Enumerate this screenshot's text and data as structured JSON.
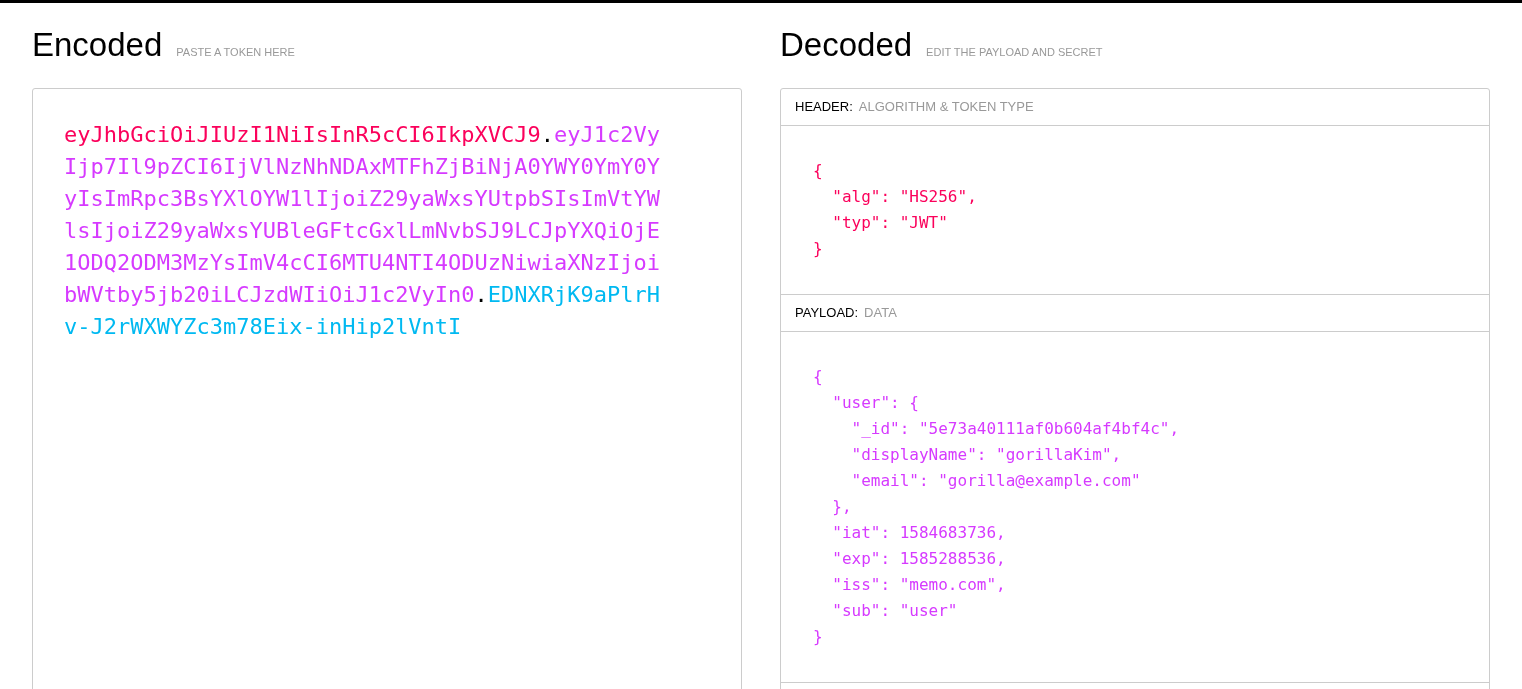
{
  "encoded": {
    "title": "Encoded",
    "hint": "PASTE A TOKEN HERE",
    "token": [
      {
        "text": "eyJhbGciOiJIUzI1NiIsInR5cCI6IkpXVCJ9",
        "color": "#fb015b"
      },
      {
        "text": ".",
        "color": "#000000"
      },
      {
        "text": "eyJ1c2VyIjp7Il9pZCI6IjVlNzNhNDAxMTFhZjBiNjA0YWY0YmY0YyIsImRpc3BsYXlOYW1lIjoiZ29yaWxsYUtpbSIsImVtYWlsIjoiZ29yaWxsYUBleGFtcGxlLmNvbSJ9LCJpYXQiOjE1ODQ2ODM3MzYsImV4cCI6MTU4NTI4ODUzNiwiaXNzIjoibWVtby5jb20iLCJzdWIiOiJ1c2VyIn0",
        "color": "#d63aff"
      },
      {
        "text": ".",
        "color": "#000000"
      },
      {
        "text": "EDNXRjK9aPlrHv-J2rWXWYZc3m78Eix-inHip2lVntI",
        "color": "#00b9f1"
      }
    ]
  },
  "decoded": {
    "title": "Decoded",
    "hint": "EDIT THE PAYLOAD AND SECRET",
    "sections": [
      {
        "label": "HEADER:",
        "sublabel": "ALGORITHM & TOKEN TYPE",
        "color": "#fb015b",
        "lines": [
          "{",
          "  \"alg\": \"HS256\",",
          "  \"typ\": \"JWT\"",
          "}"
        ]
      },
      {
        "label": "PAYLOAD:",
        "sublabel": "DATA",
        "color": "#d63aff",
        "lines": [
          "{",
          "  \"user\": {",
          "    \"_id\": \"5e73a40111af0b604af4bf4c\",",
          "    \"displayName\": \"gorillaKim\",",
          "    \"email\": \"gorilla@example.com\"",
          "  },",
          "  \"iat\": 1584683736,",
          "  \"exp\": 1585288536,",
          "  \"iss\": \"memo.com\",",
          "  \"sub\": \"user\"",
          "}"
        ]
      }
    ]
  }
}
